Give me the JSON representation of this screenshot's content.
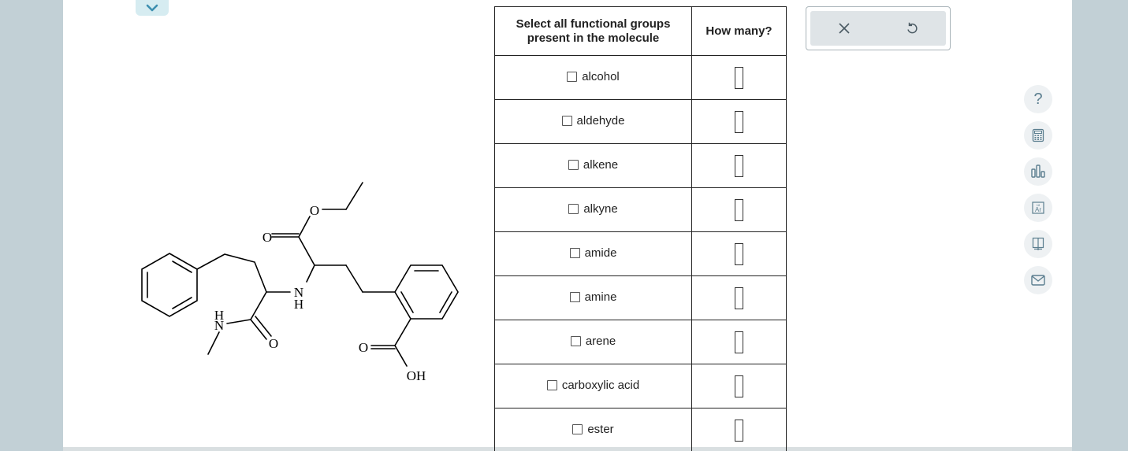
{
  "table": {
    "header_groups": "Select all functional groups present in the molecule",
    "header_count": "How many?",
    "rows": [
      {
        "label": "alcohol"
      },
      {
        "label": "aldehyde"
      },
      {
        "label": "alkene"
      },
      {
        "label": "alkyne"
      },
      {
        "label": "amide"
      },
      {
        "label": "amine"
      },
      {
        "label": "arene"
      },
      {
        "label": "carboxylic acid"
      },
      {
        "label": "ester"
      }
    ]
  },
  "molecule": {
    "atoms": {
      "o_ester_carbonyl": "O",
      "o_ester_ether": "O",
      "n_amine": "N",
      "h_amine": "H",
      "n_amide": "N",
      "h_amide": "H",
      "o_amide": "O",
      "o_acid": "O",
      "oh_acid": "OH"
    }
  },
  "side_tools": {
    "help": "?"
  },
  "colors": {
    "background": "#c2d0d6",
    "card": "#ffffff",
    "accent": "#d6ecf1",
    "icon": "#5b7e8f"
  }
}
